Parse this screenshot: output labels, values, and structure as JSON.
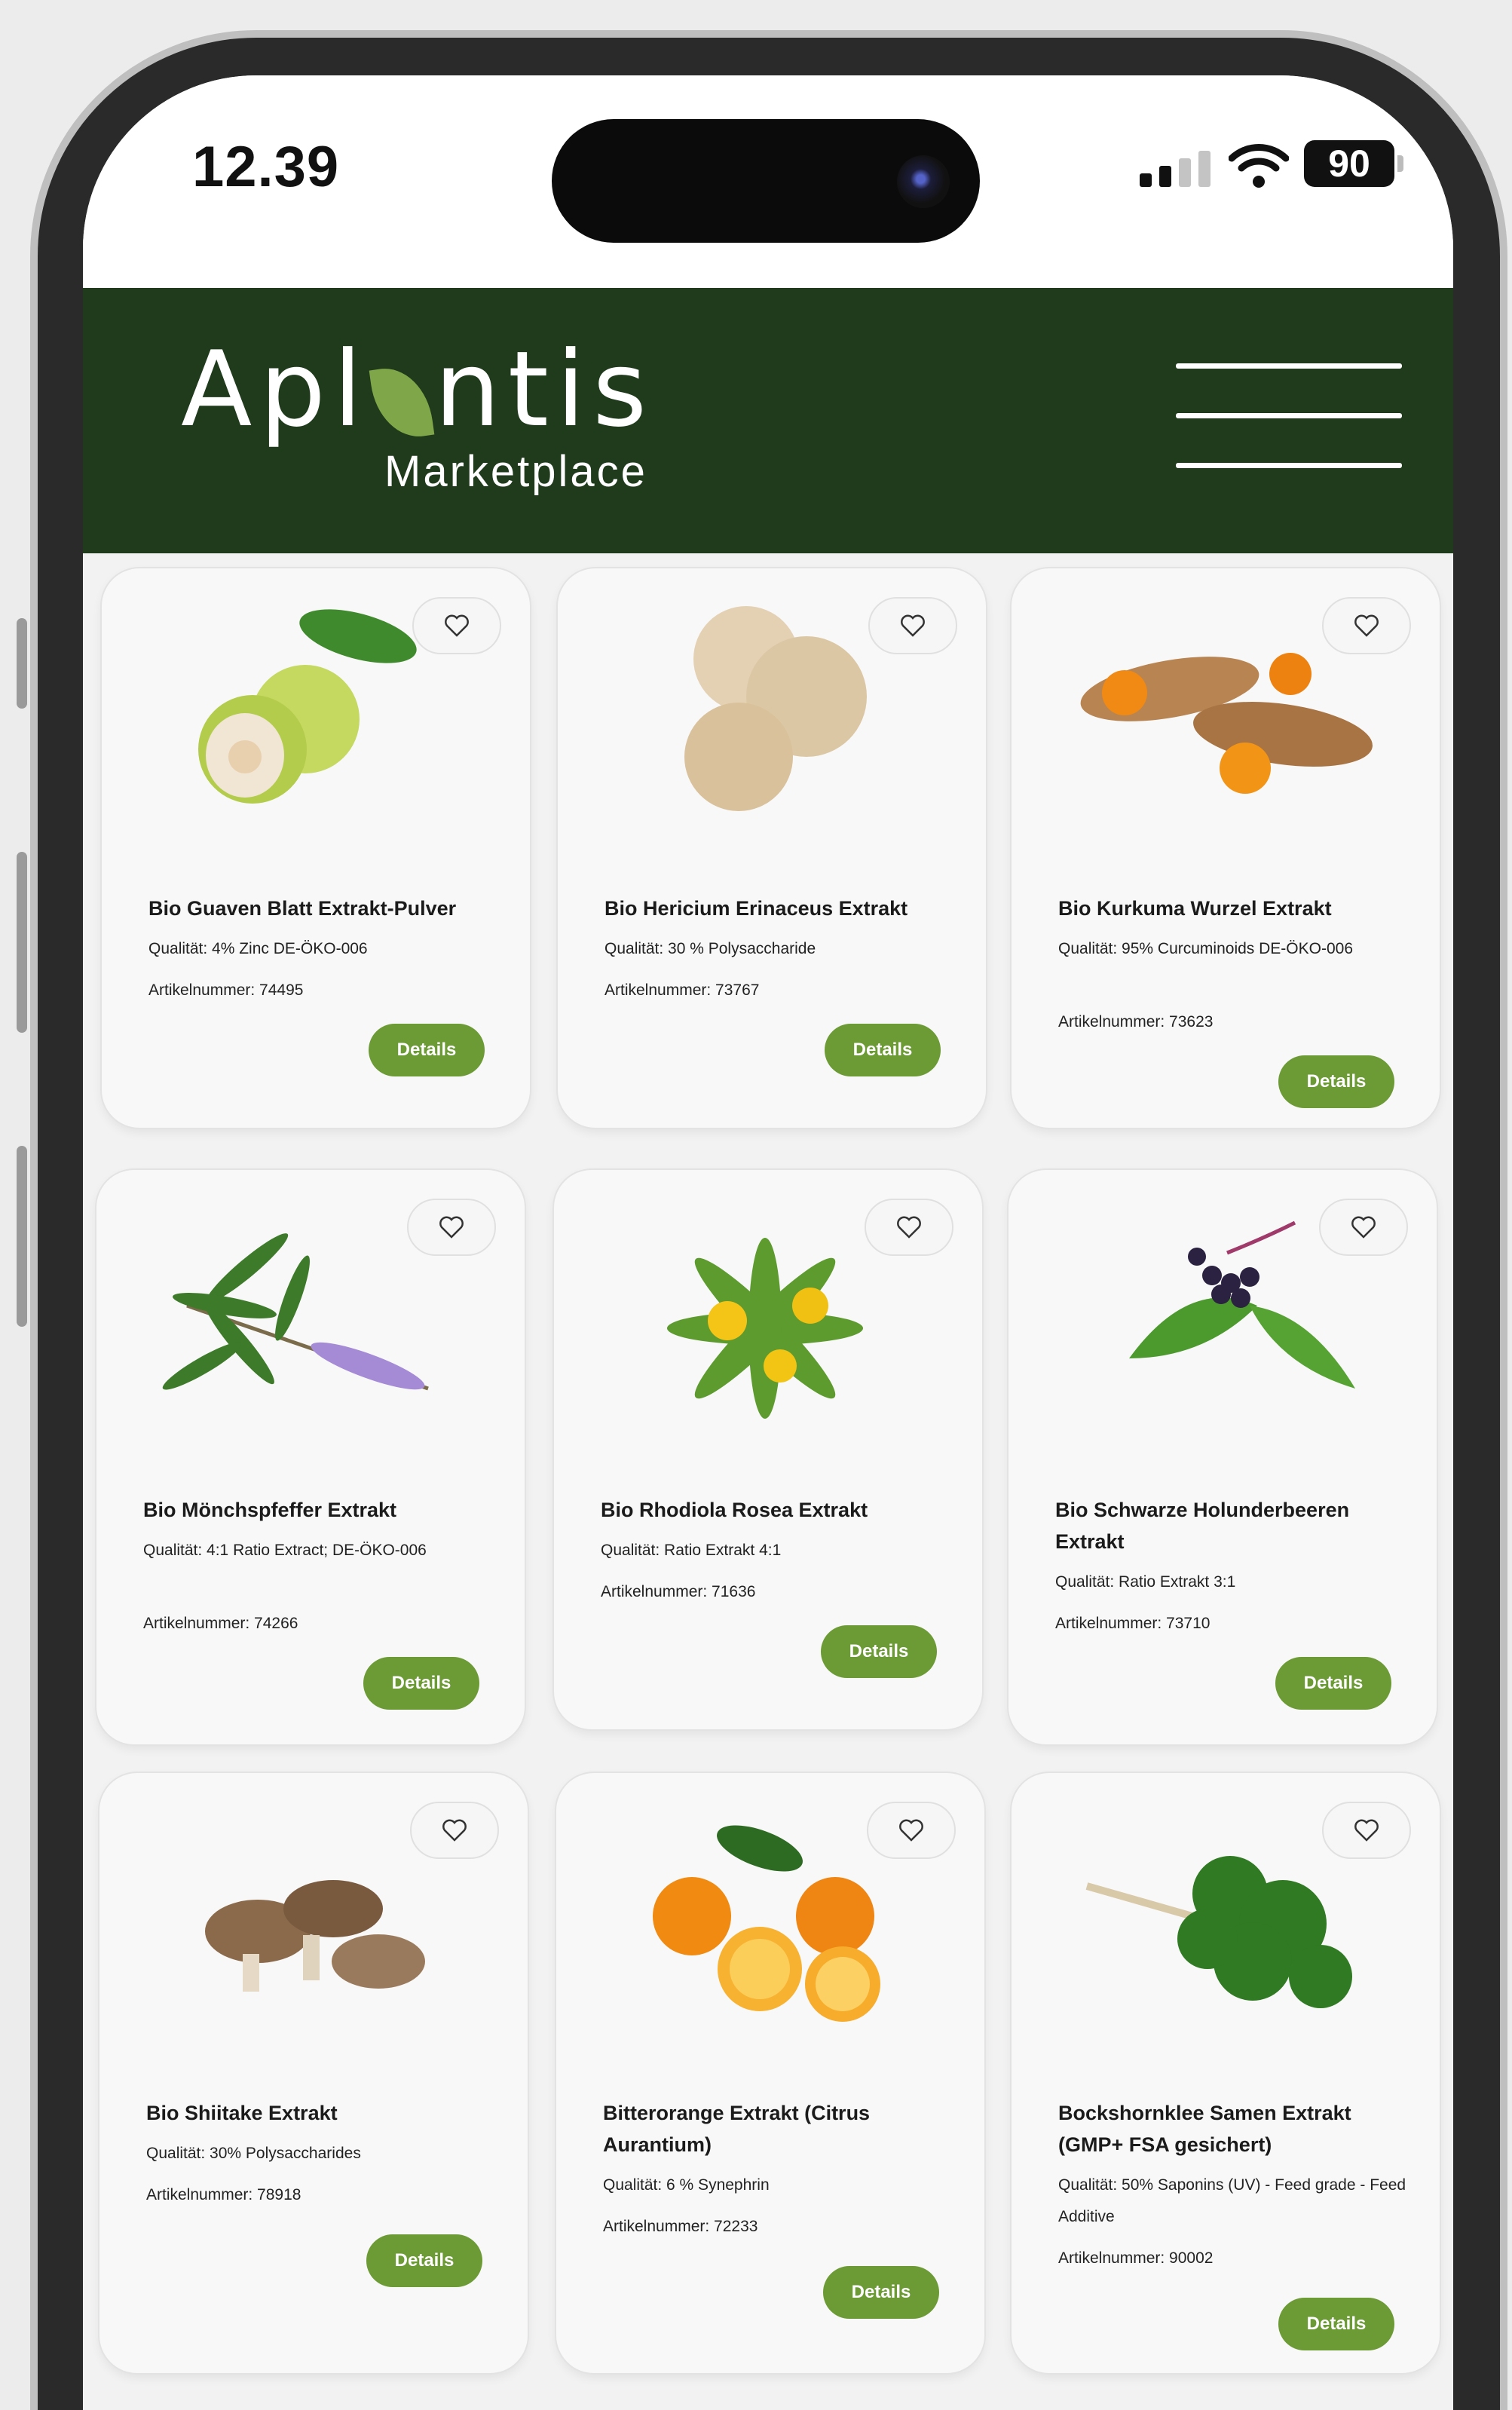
{
  "status_bar": {
    "time": "12.39",
    "battery": "90"
  },
  "header": {
    "logo_prefix": "Apl",
    "logo_suffix": "ntis",
    "logo_sub": "Marketplace"
  },
  "colors": {
    "header_bg": "#1f3b1c",
    "accent": "#6c9a35",
    "leaf": "#7fa648"
  },
  "products": [
    {
      "name": "Bio Guaven Blatt Extrakt-Pulver",
      "quality": "Qualität: 4% Zinc DE-ÖKO-006",
      "article": "Artikelnummer: 74495",
      "button": "Details",
      "image": "guava-fruit-with-leaf"
    },
    {
      "name": "Bio Hericium Erinaceus Extrakt",
      "quality": "Qualität: 30 % Polysaccharide",
      "article": "Artikelnummer: 73767",
      "button": "Details",
      "image": "lions-mane-mushrooms"
    },
    {
      "name": "Bio Kurkuma Wurzel Extrakt",
      "quality": "Qualität: 95% Curcuminoids DE-ÖKO-006",
      "article": "Artikelnummer: 73623",
      "button": "Details",
      "image": "turmeric-roots"
    },
    {
      "name": "Bio Mönchspfeffer Extrakt",
      "quality": "Qualität: 4:1 Ratio Extract; DE-ÖKO-006",
      "article": "Artikelnummer: 74266",
      "button": "Details",
      "image": "chaste-tree-branch"
    },
    {
      "name": "Bio Rhodiola Rosea Extrakt",
      "quality": "Qualität: Ratio Extrakt 4:1",
      "article": "Artikelnummer: 71636",
      "button": "Details",
      "image": "rhodiola-flowers"
    },
    {
      "name": "Bio Schwarze Holunderbeeren Extrakt",
      "quality": "Qualität: Ratio Extrakt 3:1",
      "article": "Artikelnummer: 73710",
      "button": "Details",
      "image": "elderberries-with-leaves"
    },
    {
      "name": "Bio Shiitake Extrakt",
      "quality": "Qualität: 30% Polysaccharides",
      "article": "Artikelnummer: 78918",
      "button": "Details",
      "image": "shiitake-mushrooms"
    },
    {
      "name": "Bitterorange Extrakt (Citrus Aurantium)",
      "quality": "Qualität: 6 % Synephrin",
      "article": "Artikelnummer: 72233",
      "button": "Details",
      "image": "bitter-oranges"
    },
    {
      "name": "Bockshornklee Samen Extrakt (GMP+ FSA gesichert)",
      "quality": "Qualität: 50% Saponins (UV) - Feed grade - Feed Additive",
      "article": "Artikelnummer: 90002",
      "button": "Details",
      "image": "fenugreek-greens"
    }
  ]
}
